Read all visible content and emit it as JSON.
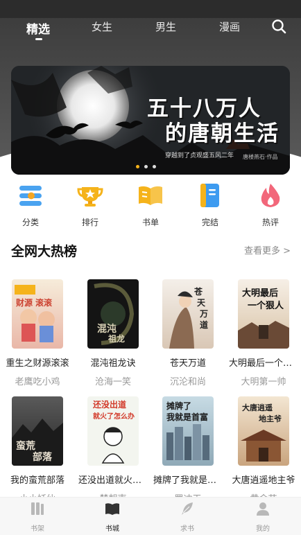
{
  "tabs": [
    {
      "label": "精选",
      "active": true
    },
    {
      "label": "女生",
      "active": false
    },
    {
      "label": "男生",
      "active": false
    },
    {
      "label": "漫画",
      "active": false
    }
  ],
  "banner": {
    "title_line1": "五十八万人",
    "title_line2": "的唐朝生活",
    "subtitle": "穿越到了贞观盛五风二年",
    "author": "唐楼燕石·作品",
    "page_count": 3,
    "active_page": 1
  },
  "categories": [
    {
      "label": "分类",
      "icon": "category-icon"
    },
    {
      "label": "排行",
      "icon": "trophy-icon"
    },
    {
      "label": "书单",
      "icon": "open-book-icon"
    },
    {
      "label": "完结",
      "icon": "finished-book-icon"
    },
    {
      "label": "热评",
      "icon": "flame-icon"
    }
  ],
  "section": {
    "title": "全网大热榜",
    "more": "查看更多 >"
  },
  "books": [
    {
      "title": "重生之财源滚滚",
      "author": "老鹰吃小鸡"
    },
    {
      "title": "混沌祖龙诀",
      "author": "沧海一笑"
    },
    {
      "title": "苍天万道",
      "author": "沉沦和尚"
    },
    {
      "title": "大明最后一个狠…",
      "author": "大明第一帅"
    },
    {
      "title": "我的蛮荒部落",
      "author": "小小妖仙"
    },
    {
      "title": "还没出道就火了…",
      "author": "楚朝南"
    },
    {
      "title": "摊牌了我就是首…",
      "author": "罗冲天"
    },
    {
      "title": "大唐逍遥地主爷",
      "author": "黄金节"
    }
  ],
  "covers": [
    {
      "text": "财源滚滚",
      "bg": "#f3e6d2"
    },
    {
      "text": "混沌祖龙诀",
      "bg": "#1c1c1c"
    },
    {
      "text": "苍天万道",
      "bg": "#efe7df"
    },
    {
      "text": "大明最后一个狠人",
      "bg": "#f1e8dd"
    },
    {
      "text": "我的蛮荒部落",
      "bg": "#3b3b3b"
    },
    {
      "text": "还没出道就火了怎么办",
      "bg": "#f4f4f0"
    },
    {
      "text": "摊牌了我就是首富",
      "bg": "#a9c2ce"
    },
    {
      "text": "大唐逍遥地主爷",
      "bg": "#e9d8c2"
    }
  ],
  "bottom_nav": [
    {
      "label": "书架",
      "icon": "bookshelf-icon",
      "active": false
    },
    {
      "label": "书城",
      "icon": "bookstore-icon",
      "active": true
    },
    {
      "label": "求书",
      "icon": "feather-icon",
      "active": false
    },
    {
      "label": "我的",
      "icon": "user-icon",
      "active": false
    }
  ],
  "colors": {
    "accent_yellow": "#f5b31b",
    "tab_active": "#ffffff",
    "text_muted": "#999999"
  }
}
